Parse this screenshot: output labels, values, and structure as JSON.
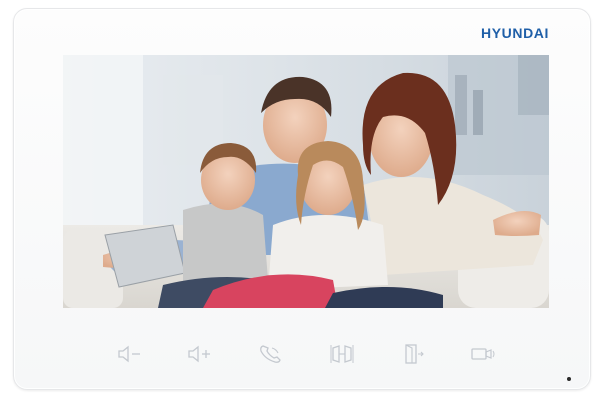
{
  "brand": {
    "logo_text": "HYUNDAI",
    "color": "#1f5fa8"
  },
  "screen": {
    "content": "video-feed-photo"
  },
  "buttons": [
    {
      "icon": "volume-down-icon"
    },
    {
      "icon": "volume-up-icon"
    },
    {
      "icon": "talk-handset-icon"
    },
    {
      "icon": "unlock-gate-icon"
    },
    {
      "icon": "open-door-icon"
    },
    {
      "icon": "camera-monitor-icon"
    }
  ],
  "colors": {
    "bezel": "#f7f8f9",
    "icon": "#c4c9cf"
  }
}
